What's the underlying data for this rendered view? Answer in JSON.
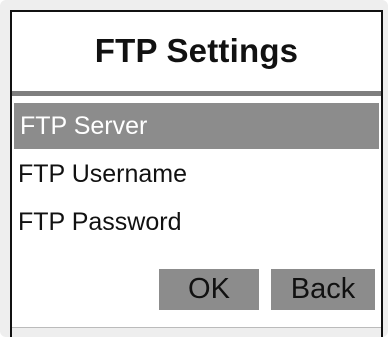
{
  "window": {
    "title": "FTP Settings"
  },
  "menu": {
    "items": [
      {
        "label": "FTP Server",
        "selected": true
      },
      {
        "label": "FTP Username",
        "selected": false
      },
      {
        "label": "FTP Password",
        "selected": false
      }
    ]
  },
  "buttons": {
    "ok_label": "OK",
    "back_label": "Back"
  },
  "colors": {
    "selection": "#8c8c8c",
    "divider": "#7f7f7f",
    "button": "#8c8c8c"
  }
}
